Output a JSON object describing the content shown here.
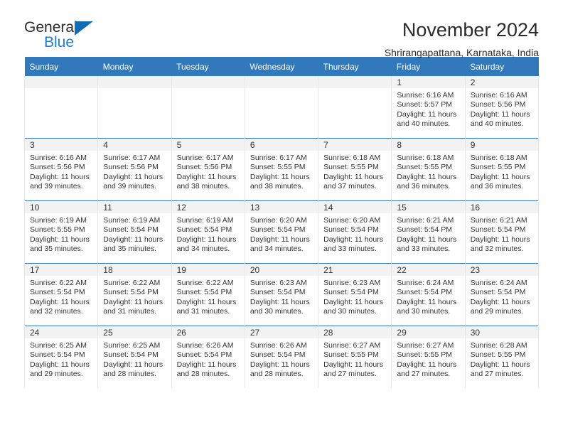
{
  "brand": {
    "name_part1": "General",
    "name_part2": "Blue",
    "triangle_color": "#106cb4",
    "blue_color": "#1b7fd4"
  },
  "header": {
    "title": "November 2024",
    "subtitle": "Shrirangapattana, Karnataka, India"
  },
  "theme": {
    "header_row_bg": "#3179ba",
    "daynum_strip_bg": "#f2f2f2",
    "cell_border": "#e8e8e8",
    "week_separator": "#3179ba"
  },
  "weekdays": [
    "Sunday",
    "Monday",
    "Tuesday",
    "Wednesday",
    "Thursday",
    "Friday",
    "Saturday"
  ],
  "labels": {
    "sunrise_prefix": "Sunrise: ",
    "sunset_prefix": "Sunset: ",
    "daylight_prefix": "Daylight: "
  },
  "weeks": [
    [
      {
        "empty": true
      },
      {
        "empty": true
      },
      {
        "empty": true
      },
      {
        "empty": true
      },
      {
        "empty": true
      },
      {
        "day": "1",
        "sunrise": "Sunrise: 6:16 AM",
        "sunset": "Sunset: 5:57 PM",
        "daylight": "Daylight: 11 hours and 40 minutes."
      },
      {
        "day": "2",
        "sunrise": "Sunrise: 6:16 AM",
        "sunset": "Sunset: 5:56 PM",
        "daylight": "Daylight: 11 hours and 40 minutes."
      }
    ],
    [
      {
        "day": "3",
        "sunrise": "Sunrise: 6:16 AM",
        "sunset": "Sunset: 5:56 PM",
        "daylight": "Daylight: 11 hours and 39 minutes."
      },
      {
        "day": "4",
        "sunrise": "Sunrise: 6:17 AM",
        "sunset": "Sunset: 5:56 PM",
        "daylight": "Daylight: 11 hours and 39 minutes."
      },
      {
        "day": "5",
        "sunrise": "Sunrise: 6:17 AM",
        "sunset": "Sunset: 5:56 PM",
        "daylight": "Daylight: 11 hours and 38 minutes."
      },
      {
        "day": "6",
        "sunrise": "Sunrise: 6:17 AM",
        "sunset": "Sunset: 5:55 PM",
        "daylight": "Daylight: 11 hours and 38 minutes."
      },
      {
        "day": "7",
        "sunrise": "Sunrise: 6:18 AM",
        "sunset": "Sunset: 5:55 PM",
        "daylight": "Daylight: 11 hours and 37 minutes."
      },
      {
        "day": "8",
        "sunrise": "Sunrise: 6:18 AM",
        "sunset": "Sunset: 5:55 PM",
        "daylight": "Daylight: 11 hours and 36 minutes."
      },
      {
        "day": "9",
        "sunrise": "Sunrise: 6:18 AM",
        "sunset": "Sunset: 5:55 PM",
        "daylight": "Daylight: 11 hours and 36 minutes."
      }
    ],
    [
      {
        "day": "10",
        "sunrise": "Sunrise: 6:19 AM",
        "sunset": "Sunset: 5:55 PM",
        "daylight": "Daylight: 11 hours and 35 minutes."
      },
      {
        "day": "11",
        "sunrise": "Sunrise: 6:19 AM",
        "sunset": "Sunset: 5:54 PM",
        "daylight": "Daylight: 11 hours and 35 minutes."
      },
      {
        "day": "12",
        "sunrise": "Sunrise: 6:19 AM",
        "sunset": "Sunset: 5:54 PM",
        "daylight": "Daylight: 11 hours and 34 minutes."
      },
      {
        "day": "13",
        "sunrise": "Sunrise: 6:20 AM",
        "sunset": "Sunset: 5:54 PM",
        "daylight": "Daylight: 11 hours and 34 minutes."
      },
      {
        "day": "14",
        "sunrise": "Sunrise: 6:20 AM",
        "sunset": "Sunset: 5:54 PM",
        "daylight": "Daylight: 11 hours and 33 minutes."
      },
      {
        "day": "15",
        "sunrise": "Sunrise: 6:21 AM",
        "sunset": "Sunset: 5:54 PM",
        "daylight": "Daylight: 11 hours and 33 minutes."
      },
      {
        "day": "16",
        "sunrise": "Sunrise: 6:21 AM",
        "sunset": "Sunset: 5:54 PM",
        "daylight": "Daylight: 11 hours and 32 minutes."
      }
    ],
    [
      {
        "day": "17",
        "sunrise": "Sunrise: 6:22 AM",
        "sunset": "Sunset: 5:54 PM",
        "daylight": "Daylight: 11 hours and 32 minutes."
      },
      {
        "day": "18",
        "sunrise": "Sunrise: 6:22 AM",
        "sunset": "Sunset: 5:54 PM",
        "daylight": "Daylight: 11 hours and 31 minutes."
      },
      {
        "day": "19",
        "sunrise": "Sunrise: 6:22 AM",
        "sunset": "Sunset: 5:54 PM",
        "daylight": "Daylight: 11 hours and 31 minutes."
      },
      {
        "day": "20",
        "sunrise": "Sunrise: 6:23 AM",
        "sunset": "Sunset: 5:54 PM",
        "daylight": "Daylight: 11 hours and 30 minutes."
      },
      {
        "day": "21",
        "sunrise": "Sunrise: 6:23 AM",
        "sunset": "Sunset: 5:54 PM",
        "daylight": "Daylight: 11 hours and 30 minutes."
      },
      {
        "day": "22",
        "sunrise": "Sunrise: 6:24 AM",
        "sunset": "Sunset: 5:54 PM",
        "daylight": "Daylight: 11 hours and 30 minutes."
      },
      {
        "day": "23",
        "sunrise": "Sunrise: 6:24 AM",
        "sunset": "Sunset: 5:54 PM",
        "daylight": "Daylight: 11 hours and 29 minutes."
      }
    ],
    [
      {
        "day": "24",
        "sunrise": "Sunrise: 6:25 AM",
        "sunset": "Sunset: 5:54 PM",
        "daylight": "Daylight: 11 hours and 29 minutes."
      },
      {
        "day": "25",
        "sunrise": "Sunrise: 6:25 AM",
        "sunset": "Sunset: 5:54 PM",
        "daylight": "Daylight: 11 hours and 28 minutes."
      },
      {
        "day": "26",
        "sunrise": "Sunrise: 6:26 AM",
        "sunset": "Sunset: 5:54 PM",
        "daylight": "Daylight: 11 hours and 28 minutes."
      },
      {
        "day": "27",
        "sunrise": "Sunrise: 6:26 AM",
        "sunset": "Sunset: 5:54 PM",
        "daylight": "Daylight: 11 hours and 28 minutes."
      },
      {
        "day": "28",
        "sunrise": "Sunrise: 6:27 AM",
        "sunset": "Sunset: 5:55 PM",
        "daylight": "Daylight: 11 hours and 27 minutes."
      },
      {
        "day": "29",
        "sunrise": "Sunrise: 6:27 AM",
        "sunset": "Sunset: 5:55 PM",
        "daylight": "Daylight: 11 hours and 27 minutes."
      },
      {
        "day": "30",
        "sunrise": "Sunrise: 6:28 AM",
        "sunset": "Sunset: 5:55 PM",
        "daylight": "Daylight: 11 hours and 27 minutes."
      }
    ]
  ]
}
